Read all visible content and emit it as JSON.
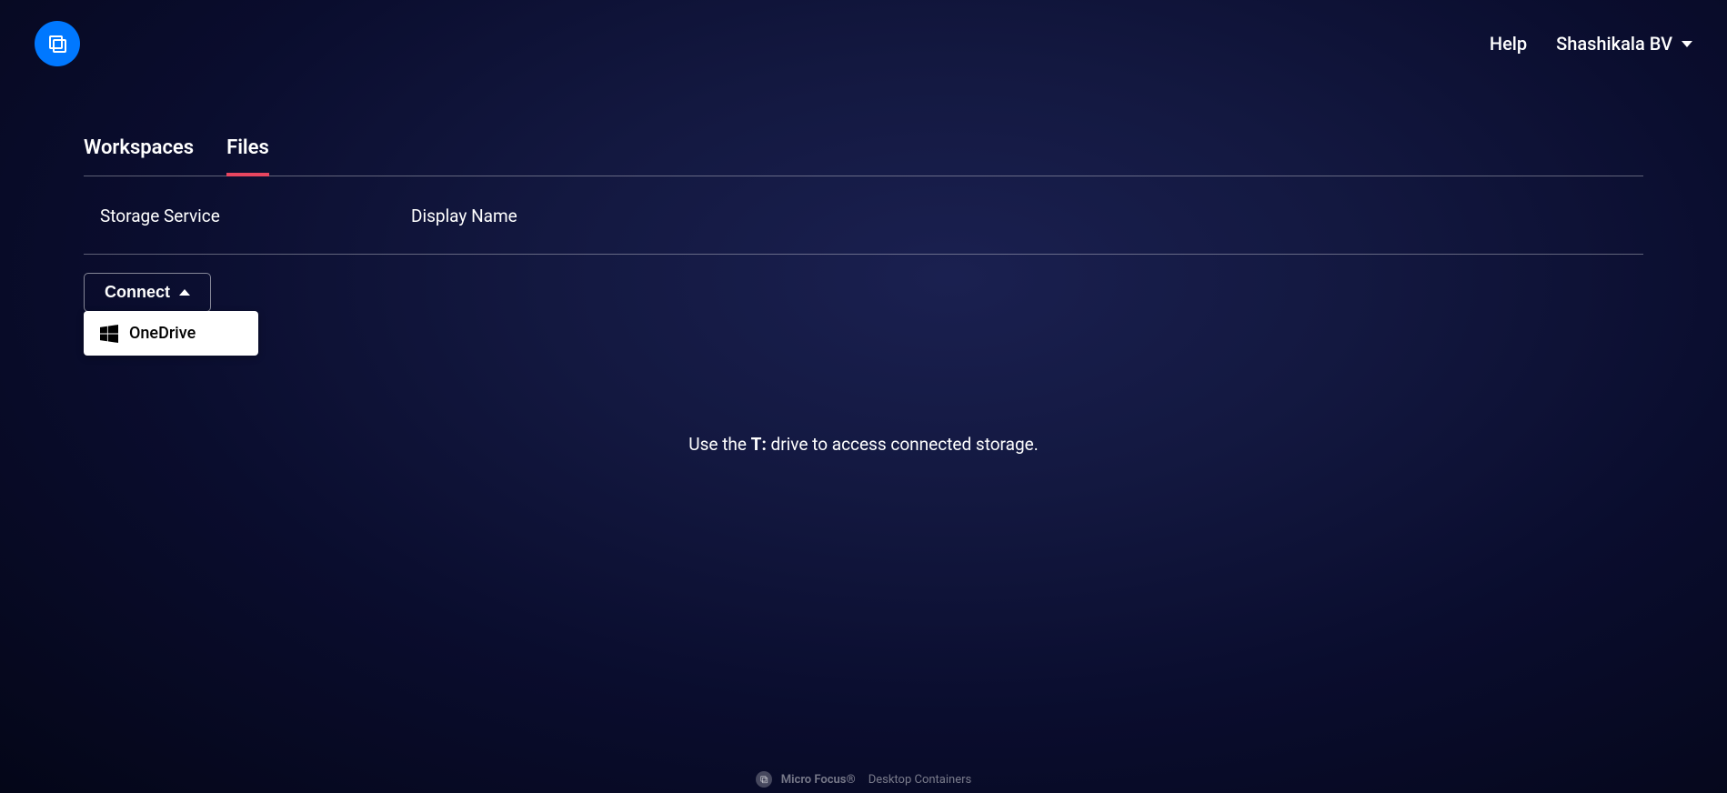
{
  "header": {
    "help_label": "Help",
    "user_name": "Shashikala BV"
  },
  "tabs": [
    {
      "label": "Workspaces",
      "active": false
    },
    {
      "label": "Files",
      "active": true
    }
  ],
  "table": {
    "columns": [
      "Storage Service",
      "Display Name"
    ]
  },
  "connect": {
    "button_label": "Connect",
    "options": [
      {
        "label": "OneDrive",
        "icon": "windows-icon"
      }
    ]
  },
  "hint": {
    "prefix": "Use the ",
    "drive": "T:",
    "suffix": " drive to access connected storage."
  },
  "footer": {
    "company": "Micro Focus®",
    "product": "Desktop Containers"
  }
}
